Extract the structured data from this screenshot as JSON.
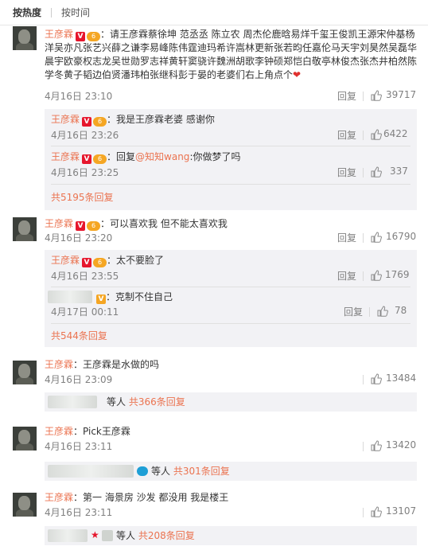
{
  "sort": {
    "hot": "按热度",
    "time": "按时间"
  },
  "comments": [
    {
      "user": "王彦霖",
      "text_lines": [
        "：请王彦霖蔡徐坤 范丞丞 陈立农 周杰伦鹿晗易烊千玺王俊凯王源宋仲基杨",
        "洋吴亦凡张艺兴薛之谦李易峰陈伟霆迪玛希许嵩林更新张若昀任嘉伦马天宇刘昊然吴磊华",
        "晨宇欧豪权志龙吴世勋罗志祥黄轩窦骁许魏洲胡歌李钟硕郑恺白敬亭林俊杰张杰井柏然陈",
        "学冬黄子韬边伯贤潘玮柏张继科彭于晏的老婆们右上角点个"
      ],
      "heart": "❤",
      "time": "4月16日 23:10",
      "reply_label": "回复",
      "likes": "39717",
      "replies": [
        {
          "user": "王彦霖",
          "text": "：我是王彦霖老婆 感谢你",
          "time": "4月16日 23:26",
          "reply_label": "回复",
          "likes": "6422"
        },
        {
          "user": "王彦霖",
          "text_prefix": "：回复",
          "mention": "@知知wang",
          "text_suffix": ":你做梦了吗",
          "time": "4月16日 23:25",
          "reply_label": "回复",
          "likes": "337"
        }
      ],
      "more": "共5195条回复"
    },
    {
      "user": "王彦霖",
      "text": "：可以喜欢我 但不能太喜欢我",
      "time": "4月16日 23:20",
      "reply_label": "回复",
      "likes": "16790",
      "replies": [
        {
          "user": "王彦霖",
          "text": "：太不要脸了",
          "time": "4月16日 23:55",
          "reply_label": "回复",
          "likes": "1769"
        },
        {
          "text": "：克制不住自己",
          "time": "4月17日 00:11",
          "reply_label": "回复",
          "likes": "78"
        }
      ],
      "more": "共544条回复"
    },
    {
      "user": "王彦霖",
      "text": "：王彦霖是水做的吗",
      "time": "4月16日 23:09",
      "likes": "13484",
      "others_label": "等人",
      "more": "共366条回复"
    },
    {
      "user": "王彦霖",
      "text": "：Pick王彦霖",
      "time": "4月16日 23:11",
      "likes": "13420",
      "others_label": "等人",
      "more": "共301条回复"
    },
    {
      "user": "王彦霖",
      "text": "：第一 海景房 沙发 都没用 我是楼王",
      "time": "4月16日 23:11",
      "likes": "13107",
      "others_label": "等人",
      "more": "共208条回复"
    }
  ],
  "badges": {
    "v": "V",
    "vip": "6"
  },
  "colors": {
    "username": "#eb7350",
    "meta": "#808080",
    "reply_bg": "#f2f2f5",
    "heart": "#e0302e"
  }
}
